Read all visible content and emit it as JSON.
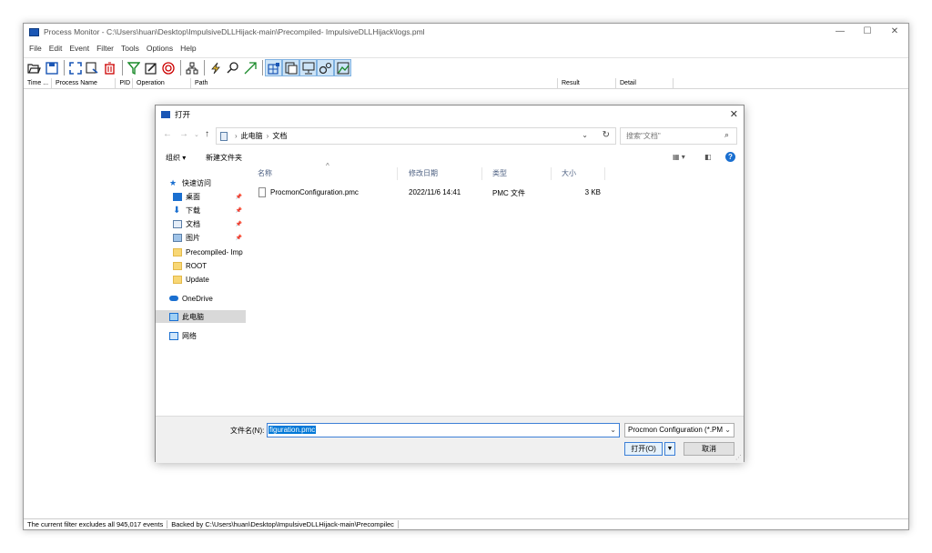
{
  "app": {
    "title": "Process Monitor - C:\\Users\\huan\\Desktop\\ImpulsiveDLLHijack-main\\Precompiled- ImpulsiveDLLHijack\\logs.pml",
    "window_controls": {
      "minimize": "—",
      "maximize": "☐",
      "close": "✕"
    },
    "menu": [
      "File",
      "Edit",
      "Event",
      "Filter",
      "Tools",
      "Options",
      "Help"
    ],
    "columns": [
      "Time ...",
      "Process Name",
      "PID",
      "Operation",
      "Path",
      "Result",
      "Detail"
    ],
    "status": {
      "filter": "The current filter excludes all 945,017 events",
      "backed": "Backed by C:\\Users\\huan\\Desktop\\ImpulsiveDLLHijack-main\\Precompilec"
    }
  },
  "dialog": {
    "title": "打开",
    "close": "✕",
    "address": {
      "segments": [
        "此电脑",
        "文档"
      ],
      "separator": "›"
    },
    "search_placeholder": "搜索\"文档\"",
    "commands": {
      "organize": "组织 ▾",
      "new_folder": "新建文件夹"
    },
    "nav": {
      "quick_access": "快速访问",
      "items": [
        {
          "label": "桌面",
          "pinned": true
        },
        {
          "label": "下载",
          "pinned": true
        },
        {
          "label": "文档",
          "pinned": true
        },
        {
          "label": "图片",
          "pinned": true
        },
        {
          "label": "Precompiled- Imp",
          "pinned": false
        },
        {
          "label": "ROOT",
          "pinned": false
        },
        {
          "label": "Update",
          "pinned": false
        }
      ],
      "onedrive": "OneDrive",
      "this_pc": "此电脑",
      "network": "网络"
    },
    "file_headers": {
      "name": "名称",
      "modified": "修改日期",
      "type": "类型",
      "size": "大小"
    },
    "files": [
      {
        "name": "ProcmonConfiguration.pmc",
        "modified": "2022/11/6 14:41",
        "type": "PMC 文件",
        "size": "3 KB"
      }
    ],
    "filename_label": "文件名(N):",
    "filename_value": "figuration.pmc",
    "filetype": "Procmon Configuration (*.PM",
    "open_label": "打开(O)",
    "cancel_label": "取消",
    "help": "?"
  },
  "colors": {
    "accent": "#0078d7",
    "selection": "#d9d9d9",
    "folder": "#f8d775"
  }
}
